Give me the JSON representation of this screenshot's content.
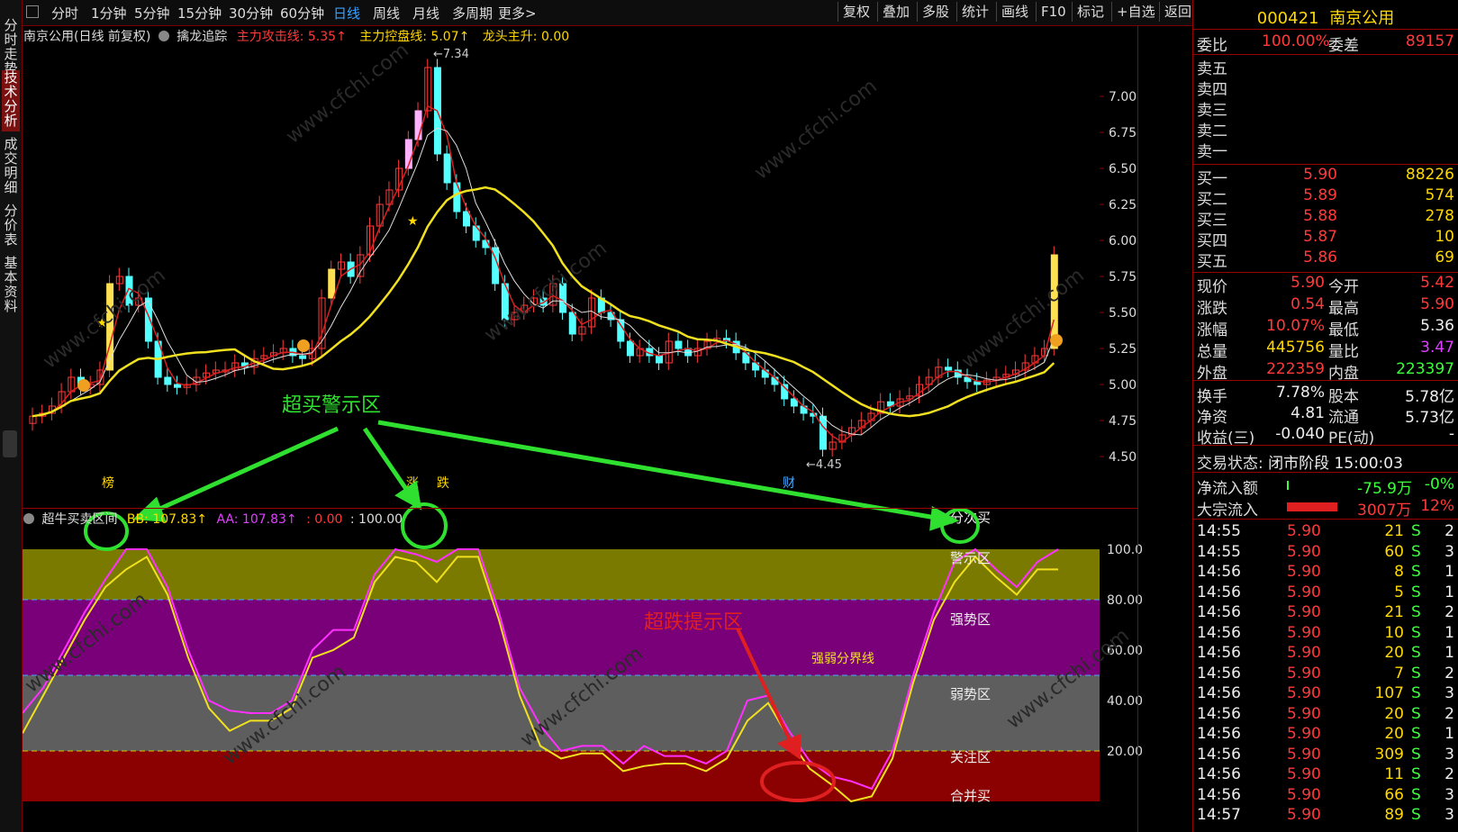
{
  "left_tabs": [
    "分时走势",
    "技术分析",
    "成交明细",
    "分价表",
    "基本资料"
  ],
  "toolbar": {
    "periods": [
      "分时",
      "1分钟",
      "5分钟",
      "15分钟",
      "30分钟",
      "60分钟",
      "日线",
      "周线",
      "月线",
      "多周期",
      "更多>"
    ],
    "selected": "日线",
    "buttons": [
      "复权",
      "叠加",
      "多股",
      "统计",
      "画线",
      "F10",
      "标记",
      "+自选",
      "返回"
    ]
  },
  "chart_info": {
    "name": "南京公用(日线 前复权)",
    "indicator": "擒龙追踪",
    "line1": "主力攻击线: 5.35↑",
    "line2": "主力控盘线: 5.07↑",
    "line3": "龙头主升: 0.00"
  },
  "indicator_info": {
    "name": "超牛买卖区间",
    "bb": "BB: 107.83↑",
    "aa": "AA: 107.83↑",
    "v1": ": 0.00",
    "v2": ": 100.00"
  },
  "annotations": {
    "overbought": "超买警示区",
    "oversold": "超跌提示区",
    "high_price": "7.34",
    "low_price": "4.45",
    "tag_bang": "榜",
    "tag_zhang": "涨",
    "tag_die": "跌",
    "tag_cai": "财"
  },
  "zones": {
    "fenci": "分次买",
    "warn": "警示区",
    "strong": "强势区",
    "divider": "强弱分界线",
    "weak": "弱势区",
    "focus": "关注区",
    "merge": "合并买"
  },
  "price_axis": [
    "7.00",
    "6.75",
    "6.50",
    "6.25",
    "6.00",
    "5.75",
    "5.50",
    "5.25",
    "5.00",
    "4.75",
    "4.50"
  ],
  "ind_axis": [
    "100.0",
    "80.00",
    "60.00",
    "40.00",
    "20.00"
  ],
  "watermark": "www.cfchi.com",
  "quote": {
    "code": "000421",
    "name": "南京公用",
    "weibi_label": "委比",
    "weibi": "100.00%",
    "weicha_label": "委差",
    "weicha": "89157",
    "sells": [
      "卖五",
      "卖四",
      "卖三",
      "卖二",
      "卖一"
    ],
    "buys": [
      {
        "label": "买一",
        "price": "5.90",
        "vol": "88226"
      },
      {
        "label": "买二",
        "price": "5.89",
        "vol": "574"
      },
      {
        "label": "买三",
        "price": "5.88",
        "vol": "278"
      },
      {
        "label": "买四",
        "price": "5.87",
        "vol": "10"
      },
      {
        "label": "买五",
        "price": "5.86",
        "vol": "69"
      }
    ],
    "stats": [
      {
        "l1": "现价",
        "v1": "5.90",
        "c1": "red",
        "l2": "今开",
        "v2": "5.42",
        "c2": "red"
      },
      {
        "l1": "涨跌",
        "v1": "0.54",
        "c1": "red",
        "l2": "最高",
        "v2": "5.90",
        "c2": "red"
      },
      {
        "l1": "涨幅",
        "v1": "10.07%",
        "c1": "red",
        "l2": "最低",
        "v2": "5.36",
        "c2": "white"
      },
      {
        "l1": "总量",
        "v1": "445756",
        "c1": "yellow",
        "l2": "量比",
        "v2": "3.47",
        "c2": "purple"
      },
      {
        "l1": "外盘",
        "v1": "222359",
        "c1": "red",
        "l2": "内盘",
        "v2": "223397",
        "c2": "green"
      }
    ],
    "stats2": [
      {
        "l1": "换手",
        "v1": "7.78%",
        "l2": "股本",
        "v2": "5.78亿"
      },
      {
        "l1": "净资",
        "v1": "4.81",
        "l2": "流通",
        "v2": "5.73亿"
      },
      {
        "l1": "收益(三)",
        "v1": "-0.040",
        "l2": "PE(动)",
        "v2": "-"
      }
    ],
    "status_label": "交易状态:",
    "status": "闭市阶段 15:00:03",
    "net_inflow_label": "净流入额",
    "net_inflow": "-75.9万",
    "net_inflow_pct": "-0%",
    "block_label": "大宗流入",
    "block": "3007万",
    "block_pct": "12%",
    "ticks": [
      {
        "t": "14:55",
        "p": "5.90",
        "v": "21",
        "s": "S",
        "n": "2"
      },
      {
        "t": "14:55",
        "p": "5.90",
        "v": "60",
        "s": "S",
        "n": "3"
      },
      {
        "t": "14:56",
        "p": "5.90",
        "v": "8",
        "s": "S",
        "n": "1"
      },
      {
        "t": "14:56",
        "p": "5.90",
        "v": "5",
        "s": "S",
        "n": "1"
      },
      {
        "t": "14:56",
        "p": "5.90",
        "v": "21",
        "s": "S",
        "n": "2"
      },
      {
        "t": "14:56",
        "p": "5.90",
        "v": "10",
        "s": "S",
        "n": "1"
      },
      {
        "t": "14:56",
        "p": "5.90",
        "v": "20",
        "s": "S",
        "n": "1"
      },
      {
        "t": "14:56",
        "p": "5.90",
        "v": "7",
        "s": "S",
        "n": "2"
      },
      {
        "t": "14:56",
        "p": "5.90",
        "v": "107",
        "s": "S",
        "n": "3"
      },
      {
        "t": "14:56",
        "p": "5.90",
        "v": "20",
        "s": "S",
        "n": "2"
      },
      {
        "t": "14:56",
        "p": "5.90",
        "v": "20",
        "s": "S",
        "n": "1"
      },
      {
        "t": "14:56",
        "p": "5.90",
        "v": "309",
        "s": "S",
        "n": "3"
      },
      {
        "t": "14:56",
        "p": "5.90",
        "v": "11",
        "s": "S",
        "n": "2"
      },
      {
        "t": "14:56",
        "p": "5.90",
        "v": "66",
        "s": "S",
        "n": "3"
      },
      {
        "t": "14:57",
        "p": "5.90",
        "v": "89",
        "s": "S",
        "n": "3"
      }
    ]
  }
}
